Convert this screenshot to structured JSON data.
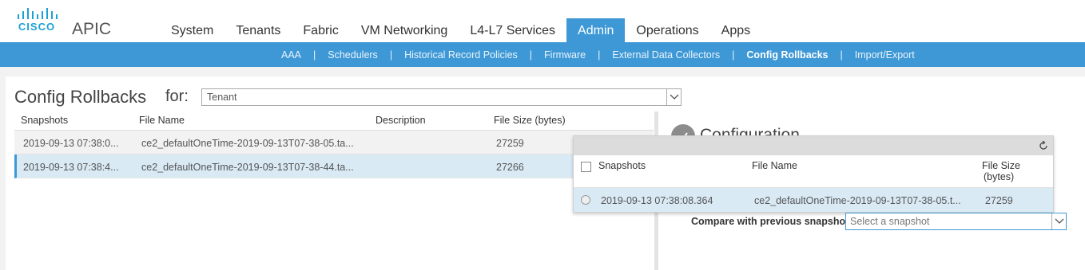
{
  "header": {
    "logo_text": "CISCO",
    "app_title": "APIC",
    "tabs": [
      {
        "label": "System"
      },
      {
        "label": "Tenants"
      },
      {
        "label": "Fabric"
      },
      {
        "label": "VM Networking"
      },
      {
        "label": "L4-L7 Services"
      },
      {
        "label": "Admin",
        "active": true
      },
      {
        "label": "Operations"
      },
      {
        "label": "Apps"
      }
    ],
    "accent_color": "#3e98d6"
  },
  "subnav": {
    "items": [
      {
        "label": "AAA"
      },
      {
        "label": "Schedulers"
      },
      {
        "label": "Historical Record Policies"
      },
      {
        "label": "Firmware"
      },
      {
        "label": "External Data Collectors"
      },
      {
        "label": "Config Rollbacks",
        "active": true
      },
      {
        "label": "Import/Export"
      }
    ],
    "separator": "|"
  },
  "page": {
    "title": "Config Rollbacks",
    "for_label": "for:",
    "for_value": "Tenant"
  },
  "snapshots_table": {
    "columns": [
      "Snapshots",
      "File Name",
      "Description",
      "File Size (bytes)"
    ],
    "rows": [
      {
        "snapshot": "2019-09-13 07:38:0...",
        "file": "ce2_defaultOneTime-2019-09-13T07-38-05.ta...",
        "description": "",
        "size": "27259",
        "selected": false
      },
      {
        "snapshot": "2019-09-13 07:38:4...",
        "file": "ce2_defaultOneTime-2019-09-13T07-38-44.ta...",
        "description": "",
        "size": "27266",
        "selected": true
      }
    ]
  },
  "config_panel": {
    "title": "Configuration",
    "icon": "check-icon",
    "compare_label": "Compare with previous snapshot:",
    "compare_placeholder": "Select a snapshot"
  },
  "popup": {
    "columns": [
      "Snapshots",
      "File Name",
      "File Size",
      "(bytes)"
    ],
    "rows": [
      {
        "snapshot": "2019-09-13 07:38:08.364",
        "file": "ce2_defaultOneTime-2019-09-13T07-38-05.t...",
        "size": "27259"
      }
    ]
  }
}
